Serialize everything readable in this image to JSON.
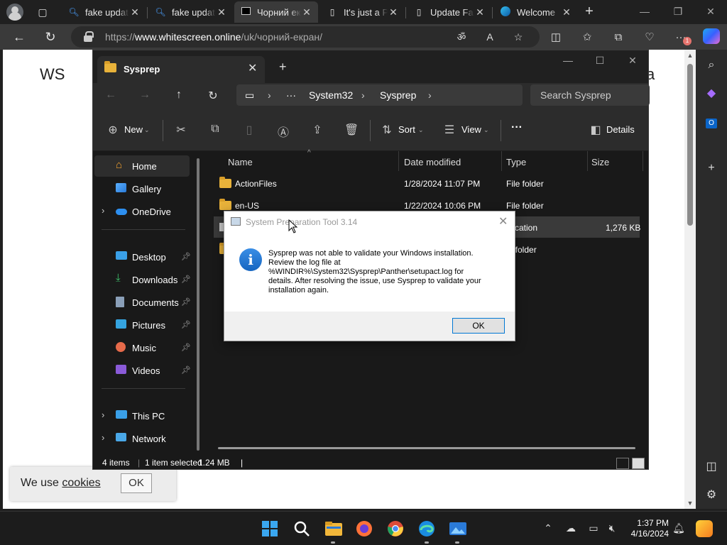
{
  "browser": {
    "tabs": [
      {
        "label": "fake update",
        "icon": "search-icon",
        "active": false
      },
      {
        "label": "fake update",
        "icon": "search-icon",
        "active": false
      },
      {
        "label": "Чорний екран",
        "icon": "black-screen-icon",
        "active": true
      },
      {
        "label": "It's just a Prank",
        "icon": "page-icon",
        "active": false
      },
      {
        "label": "Update Fake",
        "icon": "page-icon",
        "active": false
      },
      {
        "label": "Welcome",
        "icon": "edge-icon",
        "active": false
      }
    ],
    "url_prefix": "https://",
    "url_domain": "www.whitescreen.online",
    "url_path": "/uk/чорний-екран/",
    "notification_count": "1"
  },
  "webpage": {
    "heading_left": "WS",
    "heading_right": "a",
    "cookie_text": "We use ",
    "cookie_link": "cookies",
    "cookie_ok": "OK"
  },
  "explorer": {
    "tab_title": "Sysprep",
    "breadcrumb": [
      "System32",
      "Sysprep"
    ],
    "breadcrumb_more": "···",
    "search_placeholder": "Search Sysprep",
    "commands": {
      "new": "New",
      "sort": "Sort",
      "view": "View",
      "details": "Details",
      "more": "···"
    },
    "nav_items": [
      {
        "label": "Home",
        "icon": "home-icon",
        "selected": true
      },
      {
        "label": "Gallery",
        "icon": "gallery-icon"
      },
      {
        "label": "OneDrive",
        "icon": "onedrive-icon",
        "expandable": true
      },
      {
        "label": "Desktop",
        "icon": "desktop-icon",
        "pinned": true
      },
      {
        "label": "Downloads",
        "icon": "downloads-icon",
        "pinned": true
      },
      {
        "label": "Documents",
        "icon": "documents-icon",
        "pinned": true
      },
      {
        "label": "Pictures",
        "icon": "pictures-icon",
        "pinned": true
      },
      {
        "label": "Music",
        "icon": "music-icon",
        "pinned": true
      },
      {
        "label": "Videos",
        "icon": "videos-icon",
        "pinned": true
      },
      {
        "label": "This PC",
        "icon": "this-pc-icon",
        "expandable": true
      },
      {
        "label": "Network",
        "icon": "network-icon",
        "expandable": true
      }
    ],
    "columns": [
      "Name",
      "Date modified",
      "Type",
      "Size"
    ],
    "files": [
      {
        "name": "ActionFiles",
        "date": "1/28/2024 11:07 PM",
        "type": "File folder",
        "size": ""
      },
      {
        "name": "en-US",
        "date": "1/22/2024 10:06 PM",
        "type": "File folder",
        "size": ""
      },
      {
        "name": "",
        "date": "",
        "type": "plication",
        "size": "1,276 KB"
      },
      {
        "name": "",
        "date": "",
        "type": "le folder",
        "size": ""
      }
    ],
    "status": {
      "items": "4 items",
      "selected": "1 item selected",
      "size": "1.24 MB"
    }
  },
  "dialog": {
    "title": "System Preparation Tool 3.14",
    "message": "Sysprep was not able to validate your Windows installation.\nReview the log file at\n%WINDIR%\\System32\\Sysprep\\Panther\\setupact.log for\ndetails. After resolving the issue, use Sysprep to validate your\ninstallation again.",
    "ok": "OK"
  },
  "taskbar": {
    "time": "1:37 PM",
    "date": "4/16/2024",
    "apps": [
      "windows-start-icon",
      "search-icon",
      "file-explorer-icon",
      "firefox-icon",
      "chrome-icon",
      "edge-icon",
      "photos-icon"
    ]
  },
  "colors": {
    "accent": "#0078d4",
    "folder": "#e8b23a"
  }
}
